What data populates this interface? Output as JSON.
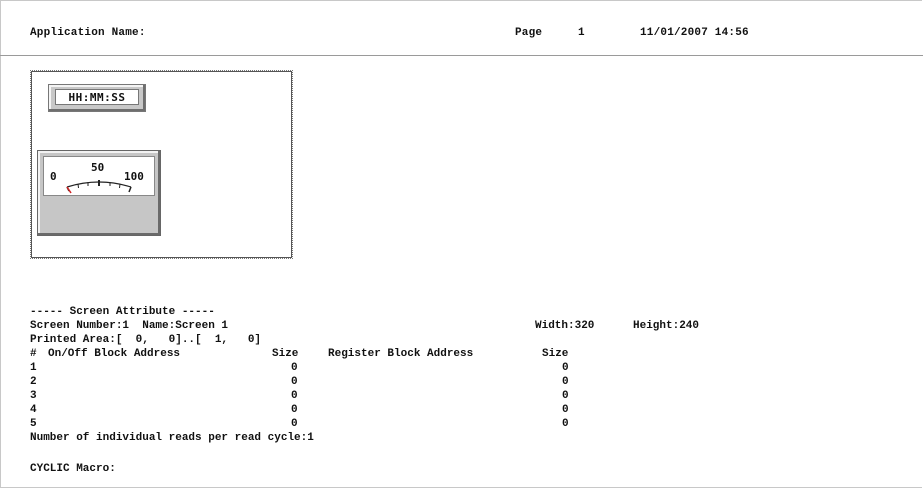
{
  "header": {
    "app_label": "Application Name:",
    "page_label": "Page",
    "page_number": "1",
    "datetime": "11/01/2007 14:56"
  },
  "preview": {
    "time_display": "HH:MM:SS",
    "meter": {
      "min": "0",
      "mid": "50",
      "max": "100"
    }
  },
  "attributes": {
    "section_title": "----- Screen Attribute -----",
    "screen_line": "Screen Number:1  Name:Screen 1",
    "width_label": "Width:320",
    "height_label": "Height:240",
    "printed_area": "Printed Area:[  0,   0]..[  1,   0]",
    "table_header": {
      "hash": "#",
      "onoff": "On/Off Block Address",
      "size1": "Size",
      "register": "Register Block Address",
      "size2": "Size"
    },
    "rows": [
      {
        "num": "1",
        "size1": "0",
        "size2": "0"
      },
      {
        "num": "2",
        "size1": "0",
        "size2": "0"
      },
      {
        "num": "3",
        "size1": "0",
        "size2": "0"
      },
      {
        "num": "4",
        "size1": "0",
        "size2": "0"
      },
      {
        "num": "5",
        "size1": "0",
        "size2": "0"
      }
    ],
    "reads_line": "Number of individual reads per read cycle:1",
    "cyclic_macro": "CYCLIC Macro:"
  }
}
